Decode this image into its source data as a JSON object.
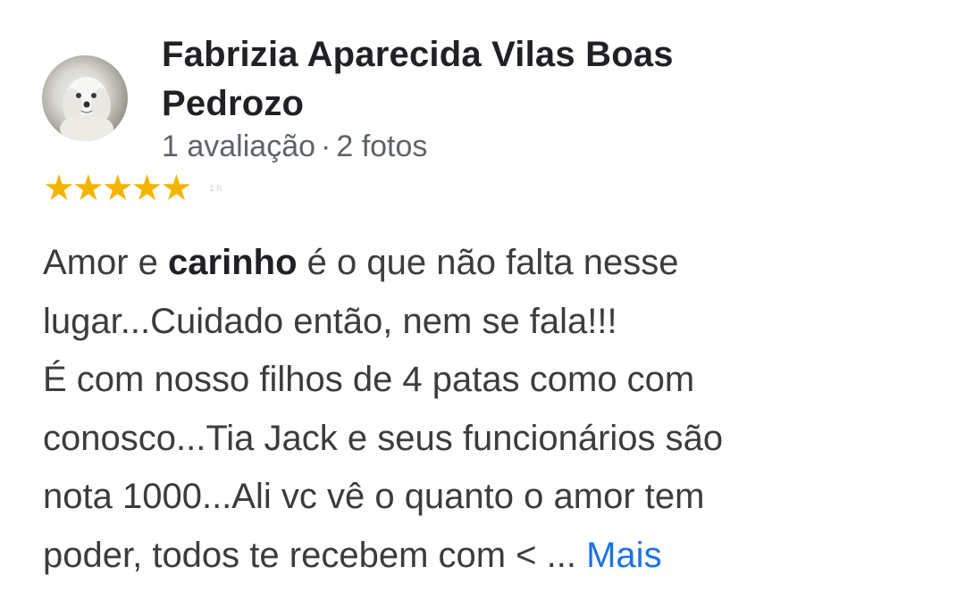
{
  "review": {
    "author": {
      "name_line_1": "Fabrizia Aparecida Vilas Boas",
      "name_line_2": "Pedrozo",
      "reviews_count": "1 avaliação",
      "separator": "·",
      "photos_count": "2 fotos",
      "avatar_icon": "dog-photo-avatar"
    },
    "rating": {
      "stars": 5,
      "max_stars": 5,
      "star_icon": "star-icon",
      "star_glyph": "★",
      "star_color": "#f5b400",
      "date": "1 h"
    },
    "text": {
      "line_1_before": "Amor e ",
      "line_1_bold": "carinho",
      "line_1_after": " é o que não falta nesse",
      "line_2": "lugar...Cuidado então, nem se fala!!!",
      "line_3": "É com nosso filhos de 4 patas como com",
      "line_4": "conosco...Tia Jack e seus funcionários são",
      "line_5": "nota 1000...Ali vc vê o quanto o amor tem",
      "line_6": "poder, todos te recebem com < ... ",
      "more_label": "Mais",
      "more_color": "#1a73e8"
    }
  }
}
